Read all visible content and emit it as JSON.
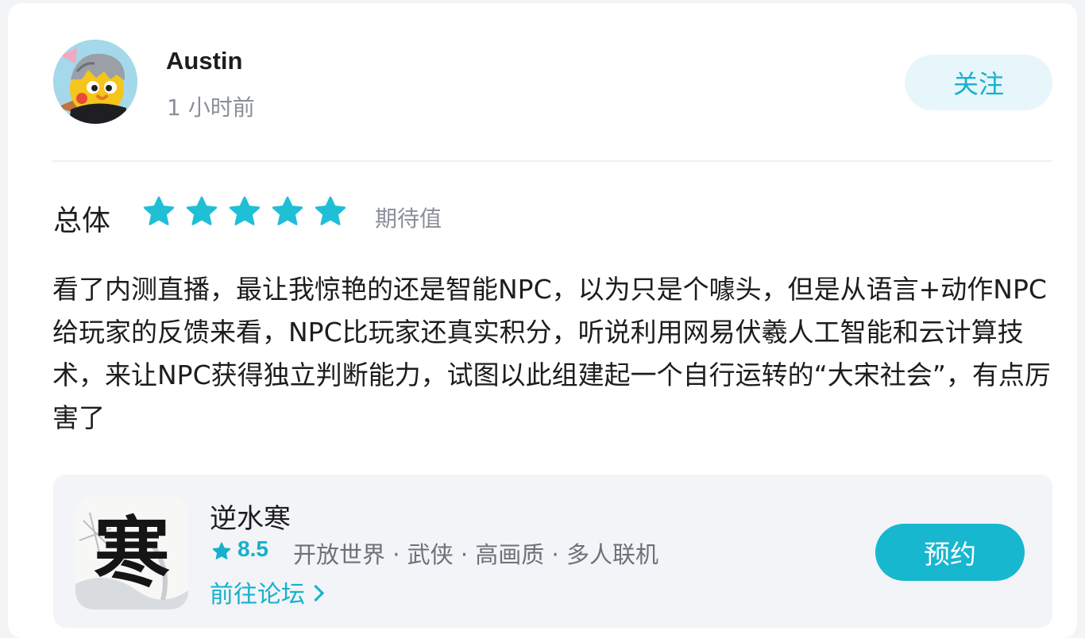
{
  "author": {
    "name": "Austin",
    "time": "1 小时前",
    "follow_label": "关注"
  },
  "rating": {
    "label": "总体",
    "stars": 5,
    "max_stars": 5,
    "tag": "期待值",
    "star_color": "#1fbfd6"
  },
  "review": {
    "text": "看了内测直播，最让我惊艳的还是智能NPC，以为只是个噱头，但是从语言+动作NPC给玩家的反馈来看，NPC比玩家还真实积分，听说利用网易伏羲人工智能和云计算技术，来让NPC获得独立判断能力，试图以此组建起一个自行运转的“大宋社会”，有点厉害了"
  },
  "game": {
    "title": "逆水寒",
    "icon_text": "寒",
    "score": "8.5",
    "tags": "开放世界 · 武侠 · 高画质 · 多人联机",
    "forum_label": "前往论坛",
    "reserve_label": "预约"
  },
  "colors": {
    "accent": "#16b0cc",
    "button_bg": "#17b7cf",
    "follow_bg": "#e6f6fa"
  }
}
